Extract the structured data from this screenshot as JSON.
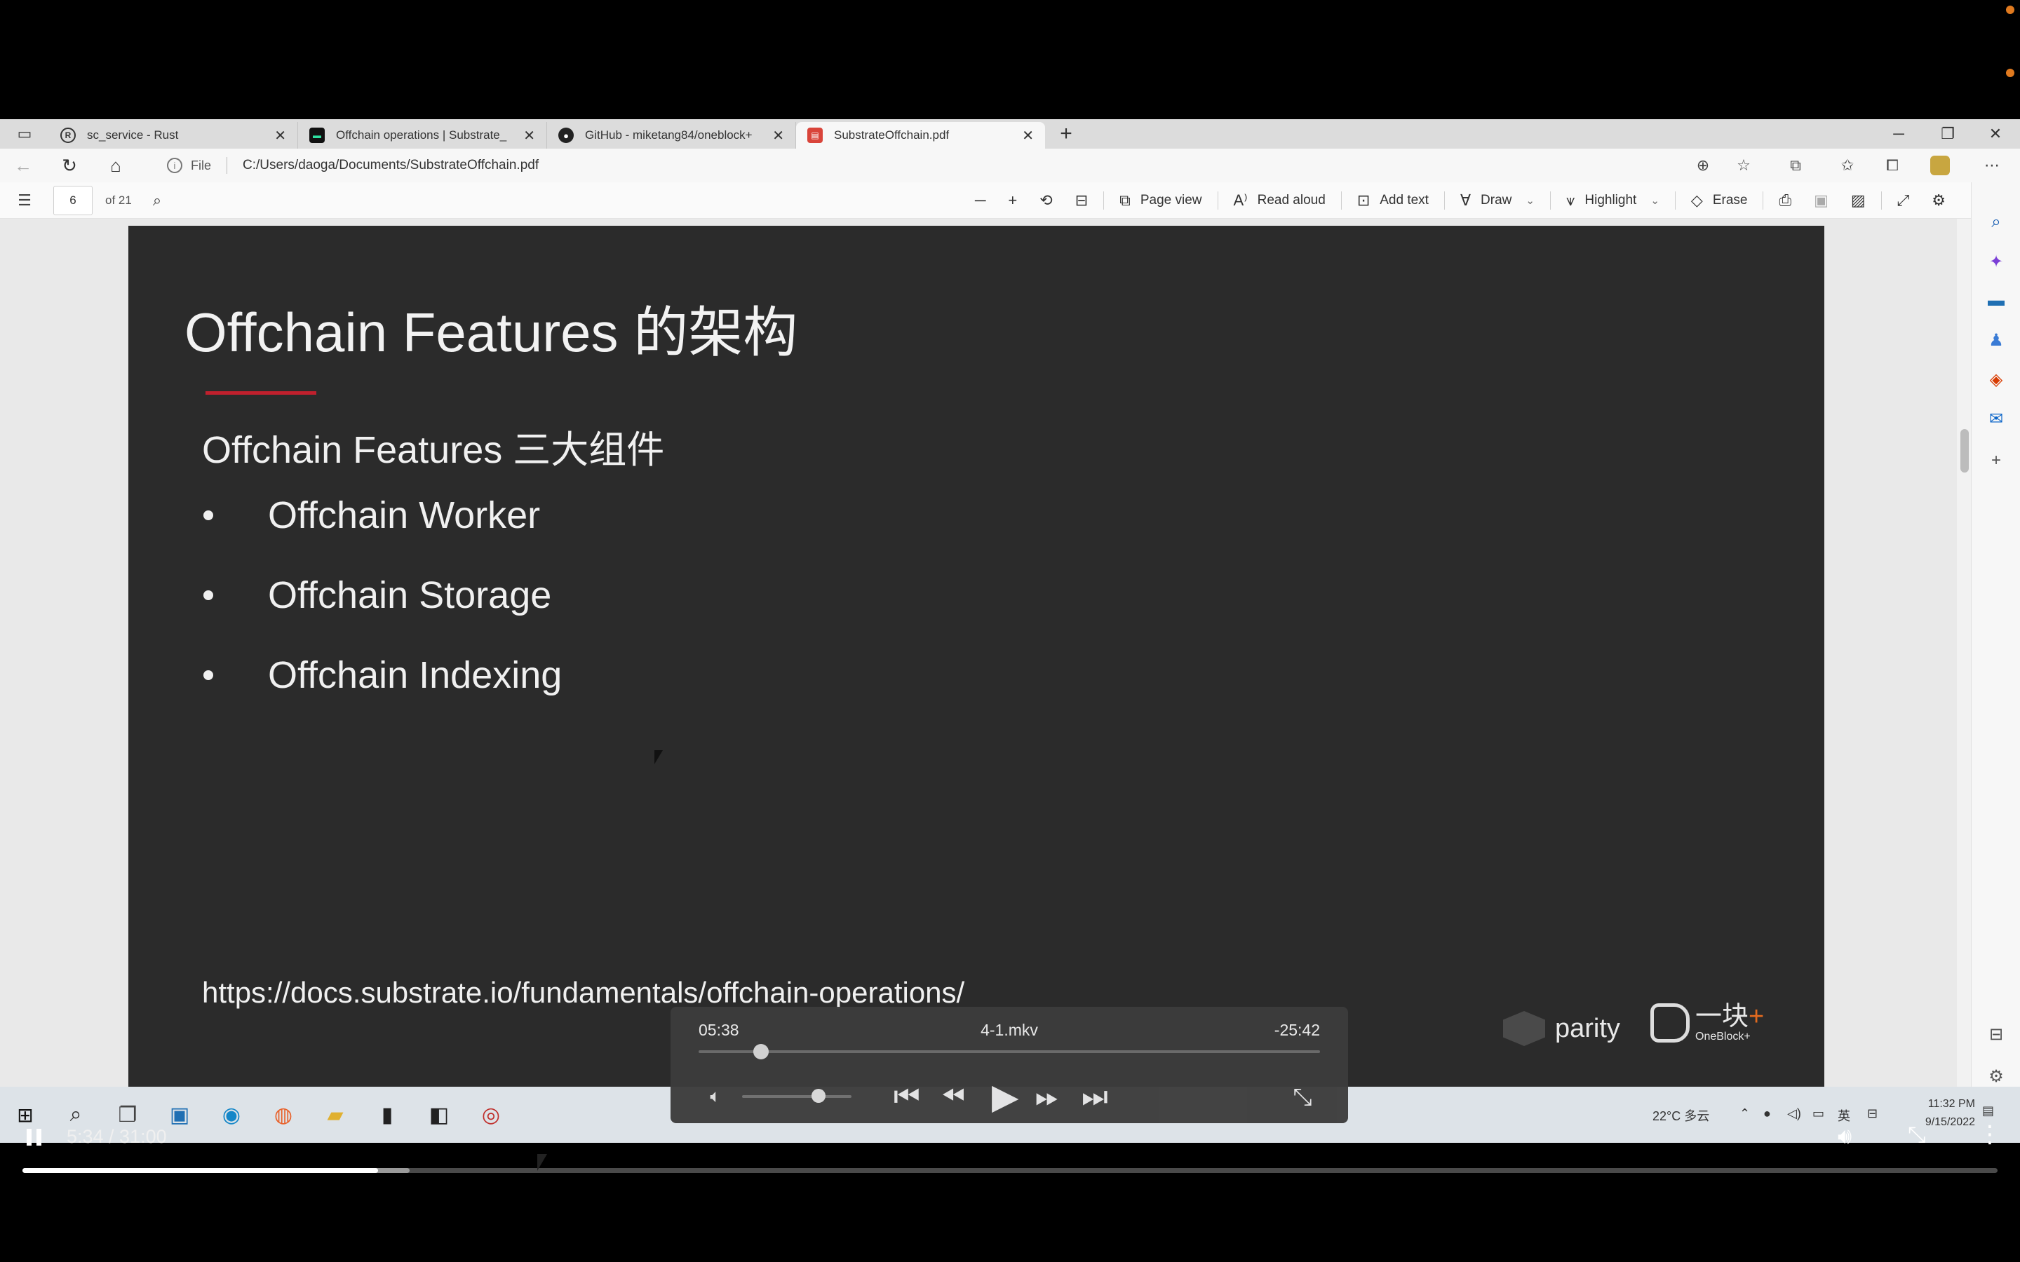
{
  "browser": {
    "tabs": [
      {
        "label": "sc_service - Rust",
        "icon": "rust-icon",
        "active": false
      },
      {
        "label": "Offchain operations | Substrate_",
        "icon": "substrate-icon",
        "active": false
      },
      {
        "label": "GitHub - miketang84/oneblock+",
        "icon": "github-icon",
        "active": false
      },
      {
        "label": "SubstrateOffchain.pdf",
        "icon": "pdf-icon",
        "active": true
      }
    ],
    "address": {
      "scheme_label": "File",
      "path": "C:/Users/daoga/Documents/SubstrateOffchain.pdf"
    }
  },
  "pdf_toolbar": {
    "page_current": "6",
    "page_total": "of 21",
    "tools": {
      "page_view": "Page view",
      "read_aloud": "Read aloud",
      "add_text": "Add text",
      "draw": "Draw",
      "highlight": "Highlight",
      "erase": "Erase"
    }
  },
  "slide": {
    "title": "Offchain Features 的架构",
    "subtitle": "Offchain Features 三大组件",
    "bullets": [
      "Offchain Worker",
      "Offchain Storage",
      "Offchain Indexing"
    ],
    "url": "https://docs.substrate.io/fundamentals/offchain-operations/",
    "logos": {
      "parity": "parity",
      "oneblock_zh": "一块",
      "oneblock_plus": "+",
      "oneblock_en": "OneBlock+"
    }
  },
  "taskbar": {
    "weather": "22°C 多云",
    "ime": "英",
    "clock_time": "11:32 PM",
    "clock_date": "9/15/2022"
  },
  "video_panel": {
    "current_time": "05:38",
    "filename": "4-1.mkv",
    "remaining_time": "-25:42",
    "seek_fraction": 0.1,
    "volume_fraction": 0.7
  },
  "video_controls": {
    "time_display": "5:34 / 31:00",
    "played_fraction": 0.18,
    "buffered_fraction": 0.196
  },
  "colors": {
    "slide_background": "#2b2b2b",
    "title_rule": "#c0202d",
    "accent_orange": "#e07a1f"
  }
}
